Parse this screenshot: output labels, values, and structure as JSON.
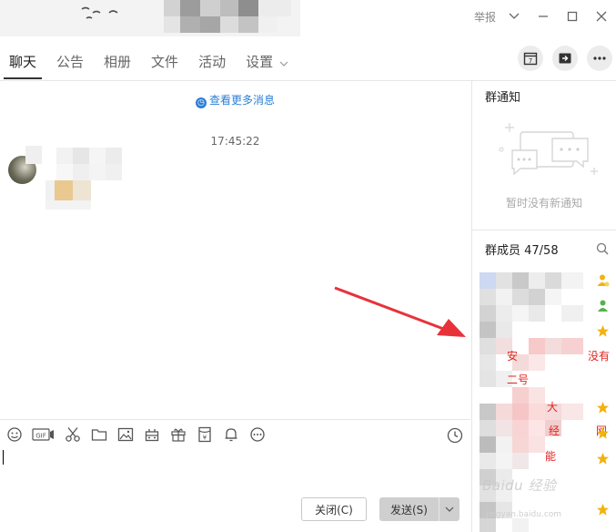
{
  "window": {
    "report_label": "举报",
    "controls": [
      "chevron-down",
      "minimize",
      "maximize",
      "close"
    ]
  },
  "tabs": [
    {
      "label": "聊天",
      "active": true
    },
    {
      "label": "公告",
      "active": false
    },
    {
      "label": "相册",
      "active": false
    },
    {
      "label": "文件",
      "active": false
    },
    {
      "label": "活动",
      "active": false
    },
    {
      "label": "设置",
      "active": false
    }
  ],
  "header_actions": [
    "calendar-icon",
    "share-icon",
    "more-icon"
  ],
  "calendar_day": "7",
  "chat": {
    "more_messages": "查看更多消息",
    "timestamp": "17:45:22"
  },
  "input_toolbar": [
    "emoji",
    "gif",
    "screenshot",
    "folder",
    "image",
    "gift-box",
    "present",
    "red-packet",
    "bell",
    "more"
  ],
  "gif_label": "GIF",
  "buttons": {
    "close": "关闭(C)",
    "send": "发送(S)"
  },
  "right_panel": {
    "notice_title": "群通知",
    "notice_empty": "暂时没有新通知",
    "members_title": "群成员 47/58"
  },
  "member_fragments": [
    {
      "text": "安",
      "color": "#e0241f"
    },
    {
      "text": "没有",
      "color": "#e0241f"
    },
    {
      "text": "二号",
      "color": "#e0241f"
    },
    {
      "text": "大",
      "color": "#e0241f"
    },
    {
      "text": "经",
      "color": "#e0241f"
    },
    {
      "text": "网",
      "color": "#e0241f"
    },
    {
      "text": "能",
      "color": "#e0241f"
    }
  ],
  "watermark": "Baidu 经验",
  "watermark_sub": "jingyan.baidu.com",
  "colors": {
    "link_blue": "#2b7fd6",
    "annotation_red": "#e8323a",
    "star_gold": "#f2b20f",
    "send_button": "#cfcfcf"
  }
}
